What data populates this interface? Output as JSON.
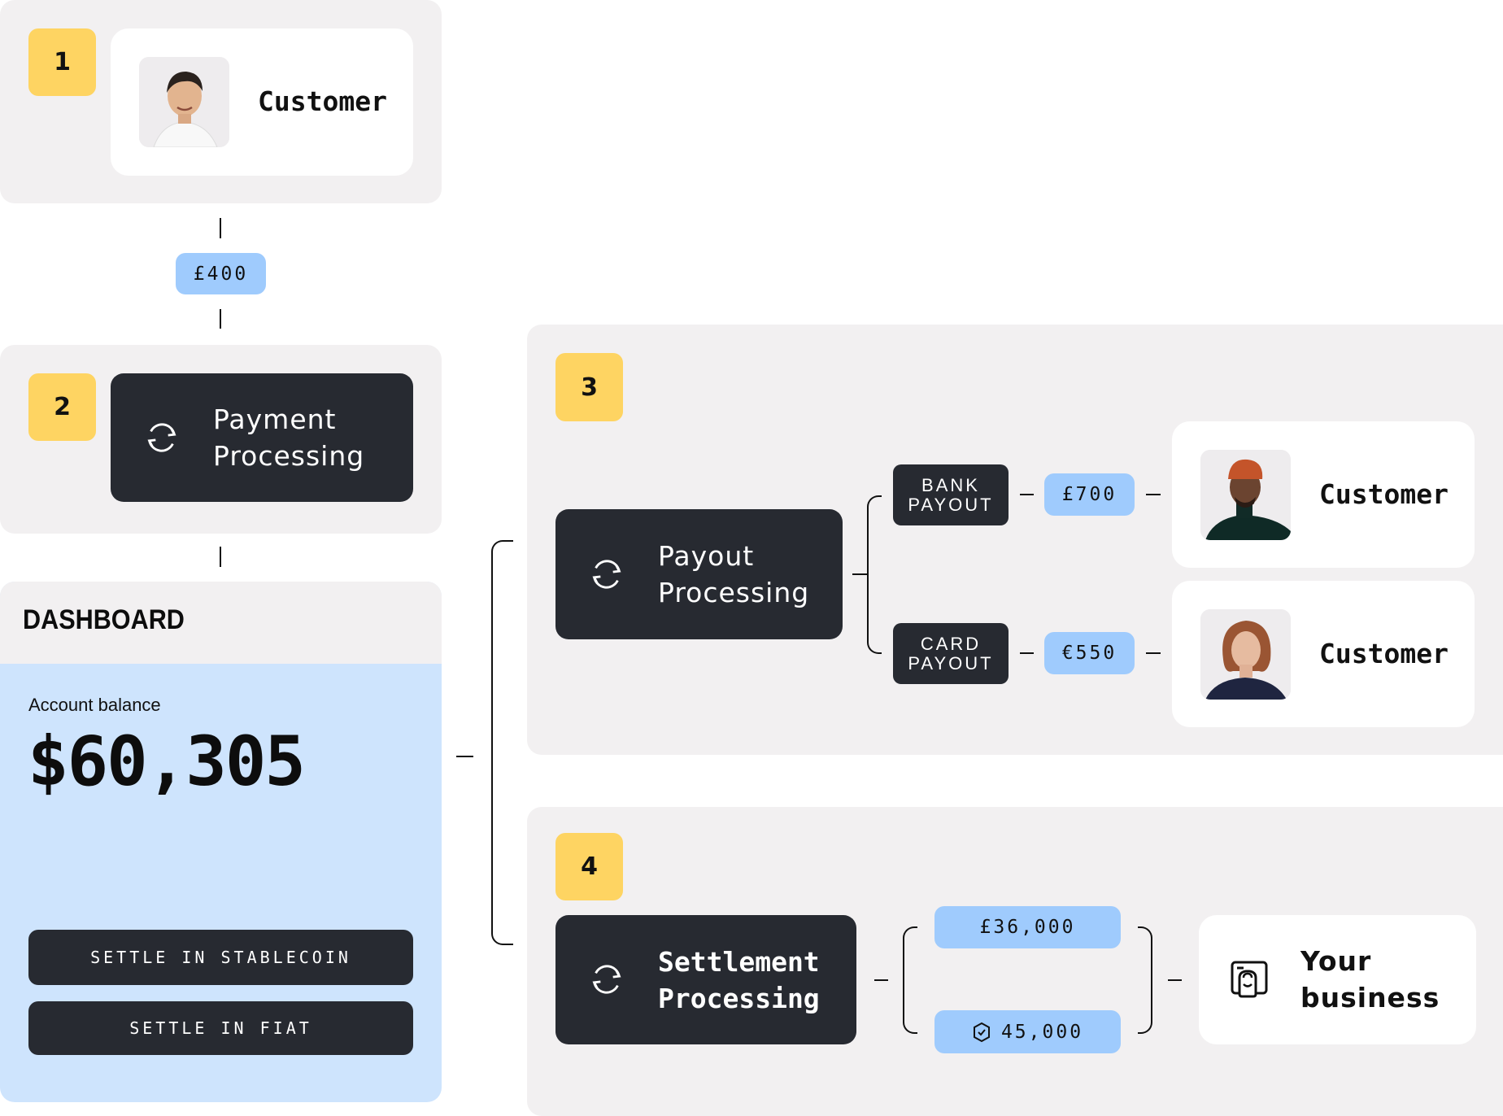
{
  "steps": [
    {
      "number": "1",
      "label": "Customer"
    },
    {
      "number": "2",
      "label_line1": "Payment",
      "label_line2": "Processing"
    },
    {
      "number": "3",
      "label_line1": "Payout",
      "label_line2": "Processing"
    },
    {
      "number": "4",
      "label_line1": "Settlement",
      "label_line2": "Processing"
    }
  ],
  "payment_amount": "£400",
  "dashboard": {
    "title": "DASHBOARD",
    "balance_label": "Account balance",
    "balance_value": "$60,305",
    "buttons": [
      "SETTLE IN STABLECOIN",
      "SETTLE IN FIAT"
    ]
  },
  "payouts": [
    {
      "method_line1": "BANK",
      "method_line2": "PAYOUT",
      "amount": "£700",
      "recipient": "Customer"
    },
    {
      "method_line1": "CARD",
      "method_line2": "PAYOUT",
      "amount": "€550",
      "recipient": "Customer"
    }
  ],
  "settlement": {
    "amounts": [
      "£36,000",
      "45,000"
    ],
    "stablecoin_icon": "hexagon-check-icon",
    "destination_line1": "Your",
    "destination_line2": "business"
  },
  "icons": {
    "process": "refresh-cycle-icon",
    "business": "shop-bag-icon",
    "avatar": "person-photo"
  },
  "colors": {
    "panel": "#f2f0f1",
    "badge": "#fed462",
    "dark": "#272a31",
    "chip": "#9fcbfd",
    "dashboard_body": "#cee4fd"
  }
}
